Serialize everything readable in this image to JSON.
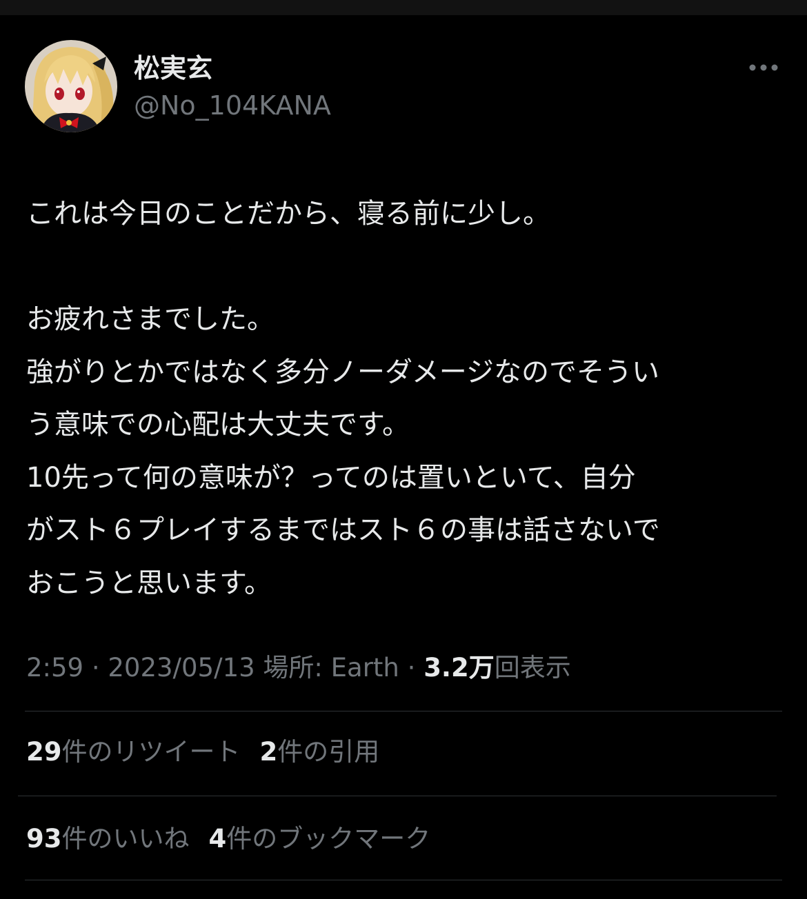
{
  "user": {
    "display_name": "松実玄",
    "handle": "@No_104KANA"
  },
  "menu": {
    "icon": "more-horizontal-icon"
  },
  "tweet": {
    "lines": [
      "これは今日のことだから、寝る前に少し。",
      "",
      "お疲れさまでした。",
      "強がりとかではなく多分ノーダメージなのでそうい",
      "う意味での心配は大丈夫です。",
      "10先って何の意味が？ってのは置いといて、自分",
      "がスト６プレイするまではスト６の事は話さないで",
      "おこうと思います。"
    ]
  },
  "meta": {
    "time": "2:59",
    "sep1": " · ",
    "date": "2023/05/13",
    "location_label": " 場所: ",
    "location": "Earth",
    "sep2": " · ",
    "views_count": "3.2万",
    "views_label": "回表示"
  },
  "stats": {
    "retweets": {
      "count": "29",
      "label": "件のリツイート"
    },
    "quotes": {
      "count": "2",
      "label": "件の引用"
    },
    "likes": {
      "count": "93",
      "label": "件のいいね"
    },
    "bookmarks": {
      "count": "4",
      "label": "件のブックマーク"
    }
  },
  "colors": {
    "background": "#000000",
    "text": "#e7e9ea",
    "secondary": "#71767b",
    "divider": "#2f3336"
  }
}
